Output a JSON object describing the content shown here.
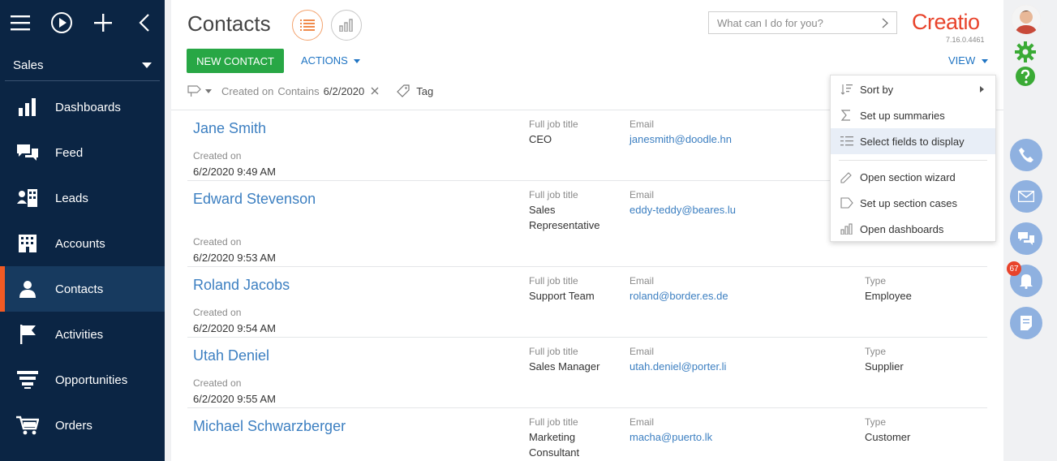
{
  "sidebar": {
    "workspace": "Sales",
    "items": [
      {
        "label": "Dashboards"
      },
      {
        "label": "Feed"
      },
      {
        "label": "Leads"
      },
      {
        "label": "Accounts"
      },
      {
        "label": "Contacts"
      },
      {
        "label": "Activities"
      },
      {
        "label": "Opportunities"
      },
      {
        "label": "Orders"
      }
    ]
  },
  "header": {
    "title": "Contacts",
    "search_placeholder": "What can I do for you?",
    "logo": "Creatio",
    "version": "7.16.0.4461",
    "new_button": "NEW CONTACT",
    "actions": "ACTIONS",
    "view": "VIEW"
  },
  "filter": {
    "field": "Created on",
    "operator": "Contains",
    "value": "6/2/2020",
    "tag": "Tag"
  },
  "labels": {
    "job": "Full job title",
    "email": "Email",
    "type": "Type",
    "created": "Created on"
  },
  "records": [
    {
      "name": "Jane Smith",
      "job1": "CEO",
      "job2": "",
      "email": "janesmith@doodle.hn",
      "type": "",
      "created": "6/2/2020 9:49 AM"
    },
    {
      "name": "Edward Stevenson",
      "job1": "Sales",
      "job2": "Representative",
      "email": "eddy-teddy@beares.lu",
      "type": "",
      "created": "6/2/2020 9:53 AM"
    },
    {
      "name": "Roland Jacobs",
      "job1": "Support Team",
      "job2": "",
      "email": "roland@border.es.de",
      "type": "Employee",
      "created": "6/2/2020 9:54 AM"
    },
    {
      "name": "Utah Deniel",
      "job1": "Sales Manager",
      "job2": "",
      "email": "utah.deniel@porter.li",
      "type": "Supplier",
      "created": "6/2/2020 9:55 AM"
    },
    {
      "name": "Michael Schwarzberger",
      "job1": "Marketing",
      "job2": "Consultant",
      "email": "macha@puerto.lk",
      "type": "Customer",
      "created": ""
    }
  ],
  "menu": {
    "sort_by": "Sort by",
    "summaries": "Set up summaries",
    "select_fields": "Select fields to display",
    "section_wizard": "Open section wizard",
    "section_cases": "Set up section cases",
    "dashboards": "Open dashboards"
  },
  "notifications_count": "67",
  "colors": {
    "sidebar": "#0b2544",
    "accent": "#f15a24",
    "primary_button": "#28a745",
    "link": "#3c7fc1"
  }
}
